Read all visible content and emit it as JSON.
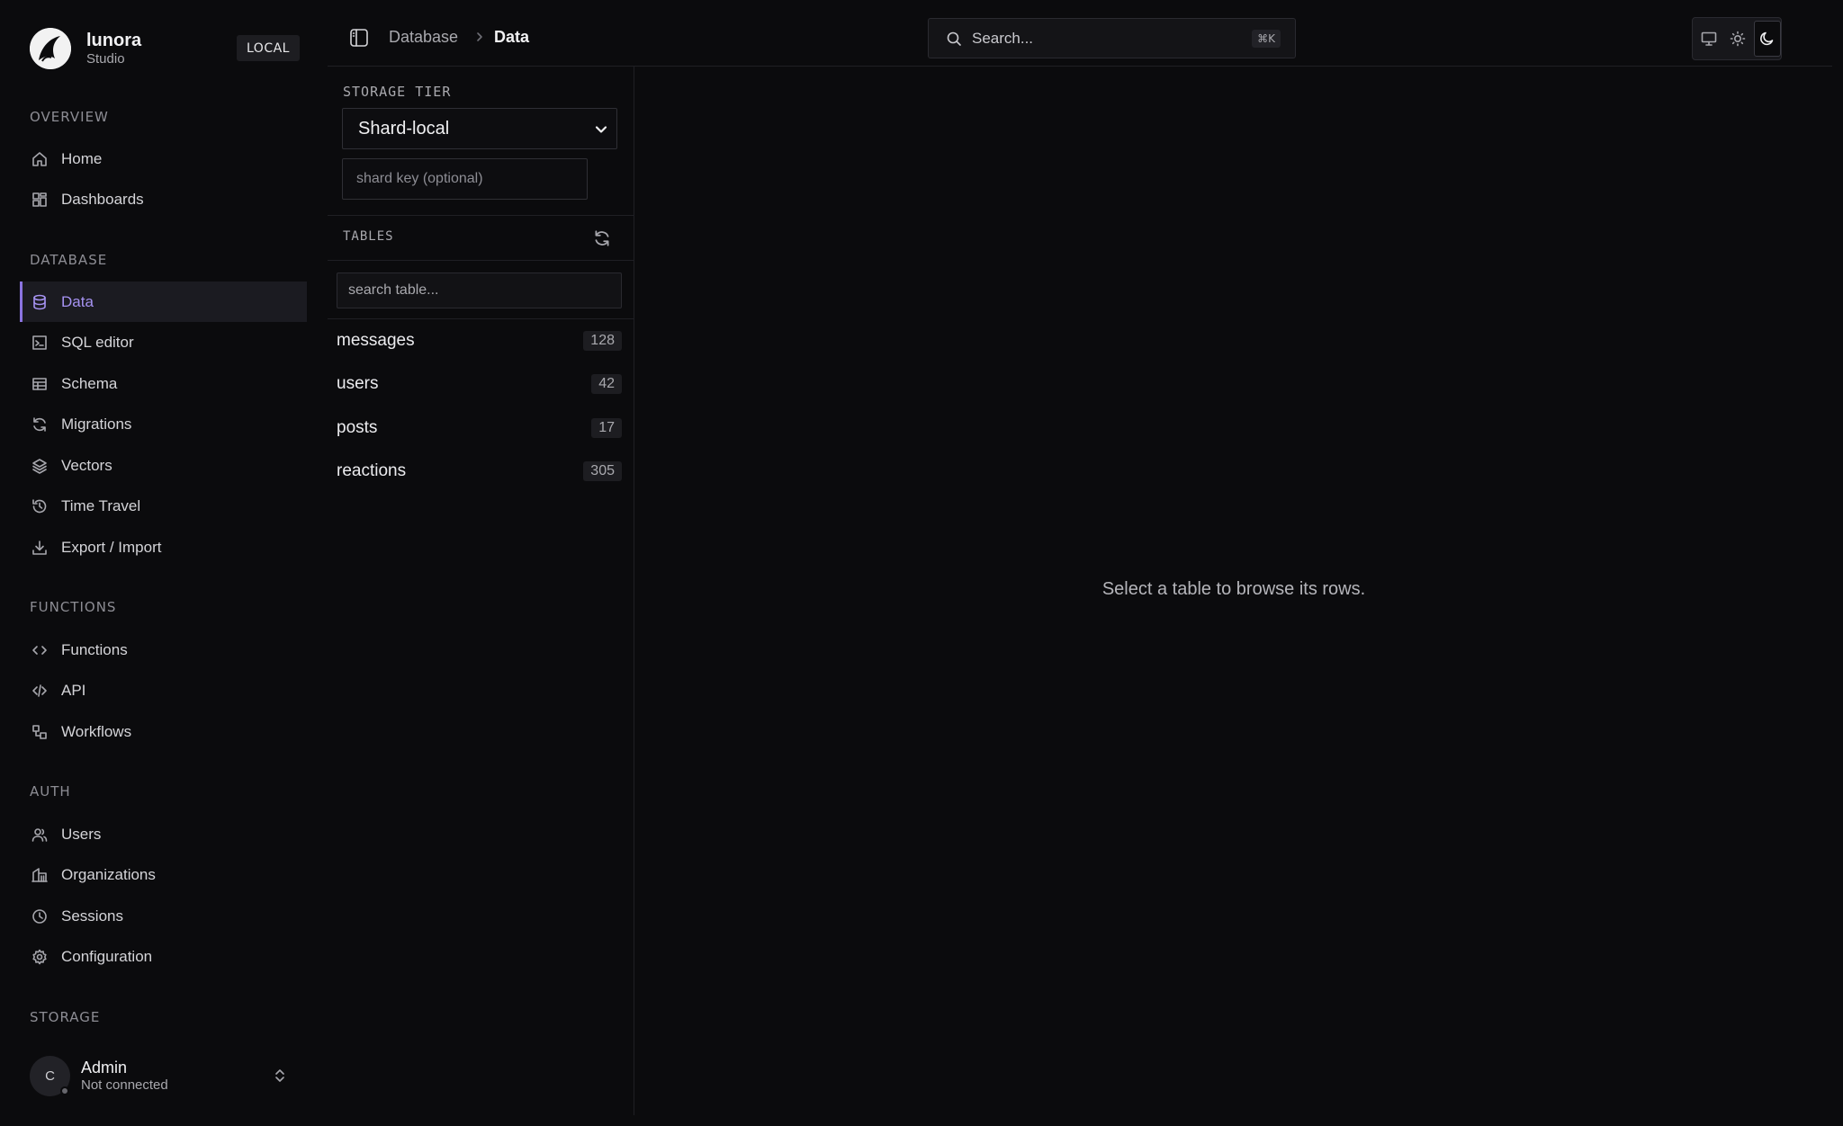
{
  "brand": {
    "name": "lunora",
    "subtitle": "Studio",
    "env_badge": "LOCAL"
  },
  "sidebar": {
    "sections": [
      {
        "label": "OVERVIEW",
        "items": [
          {
            "label": "Home",
            "icon": "home-icon"
          },
          {
            "label": "Dashboards",
            "icon": "dashboard-icon"
          }
        ]
      },
      {
        "label": "DATABASE",
        "items": [
          {
            "label": "Data",
            "icon": "database-icon",
            "active": true
          },
          {
            "label": "SQL editor",
            "icon": "terminal-icon"
          },
          {
            "label": "Schema",
            "icon": "table-icon"
          },
          {
            "label": "Migrations",
            "icon": "refresh-icon"
          },
          {
            "label": "Vectors",
            "icon": "layers-icon"
          },
          {
            "label": "Time Travel",
            "icon": "history-icon"
          },
          {
            "label": "Export / Import",
            "icon": "download-icon"
          }
        ]
      },
      {
        "label": "FUNCTIONS",
        "items": [
          {
            "label": "Functions",
            "icon": "code-icon"
          },
          {
            "label": "API",
            "icon": "code-xml-icon"
          },
          {
            "label": "Workflows",
            "icon": "workflow-icon"
          }
        ]
      },
      {
        "label": "AUTH",
        "items": [
          {
            "label": "Users",
            "icon": "users-icon"
          },
          {
            "label": "Organizations",
            "icon": "building-icon"
          },
          {
            "label": "Sessions",
            "icon": "clock-icon"
          },
          {
            "label": "Configuration",
            "icon": "gear-icon"
          }
        ]
      },
      {
        "label": "STORAGE",
        "items": []
      }
    ]
  },
  "user": {
    "initial": "C",
    "name": "Admin",
    "status": "Not connected"
  },
  "topbar": {
    "breadcrumb": {
      "parent": "Database",
      "current": "Data"
    },
    "search": {
      "placeholder": "Search...",
      "shortcut": "⌘K"
    },
    "theme_modes": [
      "monitor",
      "light",
      "dark"
    ],
    "active_theme": "dark"
  },
  "storage_panel": {
    "tier_label": "STORAGE TIER",
    "tier_value": "Shard-local",
    "shard_key_placeholder": "shard key (optional)"
  },
  "tables_panel": {
    "label": "TABLES",
    "search_placeholder": "search table...",
    "tables": [
      {
        "name": "messages",
        "count": "128"
      },
      {
        "name": "users",
        "count": "42"
      },
      {
        "name": "posts",
        "count": "17"
      },
      {
        "name": "reactions",
        "count": "305"
      }
    ]
  },
  "main": {
    "empty_message": "Select a table to browse its rows."
  },
  "colors": {
    "accent": "#8b74e0",
    "accent_text": "#a693f2",
    "background": "#0b0b0d"
  }
}
